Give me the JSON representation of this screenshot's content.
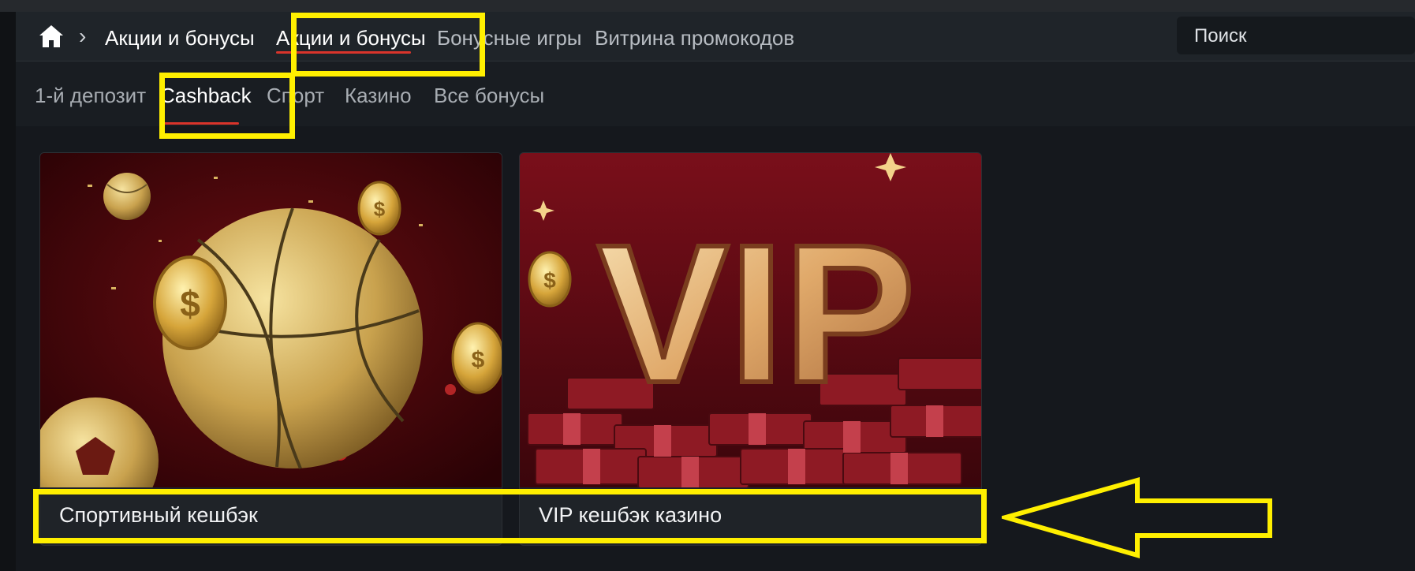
{
  "breadcrumb": {
    "current": "Акции и бонусы"
  },
  "nav": {
    "tabs": [
      {
        "label": "Акции и бонусы",
        "active": true
      },
      {
        "label": "Бонусные игры",
        "active": false
      },
      {
        "label": "Витрина промокодов",
        "active": false
      }
    ],
    "search_placeholder": "Поиск"
  },
  "subnav": {
    "tabs": [
      {
        "label": "1-й депозит",
        "active": false
      },
      {
        "label": "Cashback",
        "active": true
      },
      {
        "label": "Спорт",
        "active": false
      },
      {
        "label": "Казино",
        "active": false
      },
      {
        "label": "Все бонусы",
        "active": false
      }
    ]
  },
  "cards": [
    {
      "title": "Спортивный кешбэк",
      "image": "sports-balls-gold-coins"
    },
    {
      "title": "VIP кешбэк казино",
      "image": "vip-letters-money-stacks",
      "image_text": "VIP"
    }
  ],
  "colors": {
    "accent": "#d9342b",
    "highlight": "#ffef00",
    "background": "#15181d"
  }
}
